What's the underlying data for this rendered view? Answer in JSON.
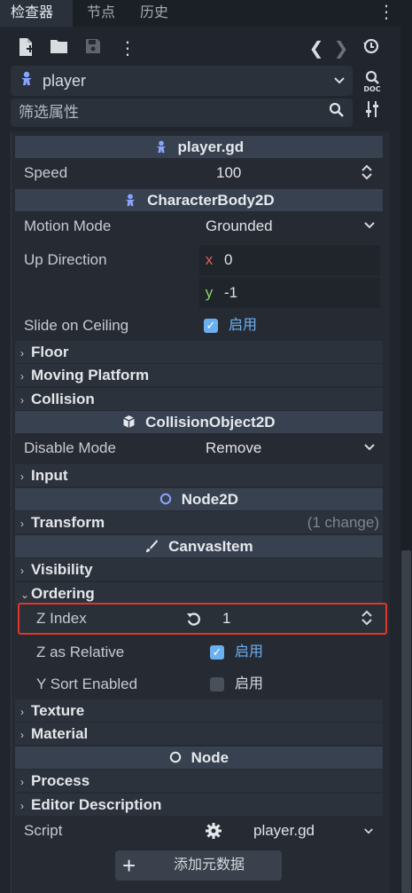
{
  "tabs": [
    {
      "label": "检查器",
      "active": true
    },
    {
      "label": "节点",
      "active": false
    },
    {
      "label": "历史",
      "active": false
    }
  ],
  "tab_menu_icon": "kebab-icon",
  "toolbar": {
    "icons": [
      "new-script-icon",
      "open-folder-icon",
      "save-icon",
      "kebab-icon",
      "back-icon",
      "forward-icon",
      "history-icon"
    ]
  },
  "node_selector": {
    "value": "player",
    "icon": "character-body-icon"
  },
  "doc_button": "DOC",
  "filter": {
    "placeholder": "筛选属性"
  },
  "sections": {
    "script": "player.gd",
    "characterbody": "CharacterBody2D",
    "collisionobject": "CollisionObject2D",
    "node2d": "Node2D",
    "canvasitem": "CanvasItem",
    "node": "Node"
  },
  "properties": {
    "speed": {
      "label": "Speed",
      "value": "100"
    },
    "motion_mode": {
      "label": "Motion Mode",
      "value": "Grounded"
    },
    "up_direction": {
      "label": "Up Direction",
      "x_label": "x",
      "x": "0",
      "y_label": "y",
      "y": "-1"
    },
    "slide_on_ceiling": {
      "label": "Slide on Ceiling",
      "checked": true,
      "text": "启用"
    },
    "disable_mode": {
      "label": "Disable Mode",
      "value": "Remove"
    },
    "z_index": {
      "label": "Z Index",
      "value": "1"
    },
    "z_as_relative": {
      "label": "Z as Relative",
      "checked": true,
      "text": "启用"
    },
    "y_sort_enabled": {
      "label": "Y Sort Enabled",
      "checked": false,
      "text": "启用"
    },
    "script": {
      "label": "Script",
      "value": "player.gd"
    }
  },
  "groups": {
    "floor": "Floor",
    "moving_platform": "Moving Platform",
    "collision": "Collision",
    "input": "Input",
    "transform": "Transform",
    "transform_change": "(1 change)",
    "visibility": "Visibility",
    "ordering": "Ordering",
    "texture": "Texture",
    "material": "Material",
    "process": "Process",
    "editor_description": "Editor Description"
  },
  "add_metadata_button": "添加元数据",
  "colors": {
    "accent": "#6ab0f0",
    "highlight_border": "#e3352a",
    "section_bg": "#384150"
  }
}
